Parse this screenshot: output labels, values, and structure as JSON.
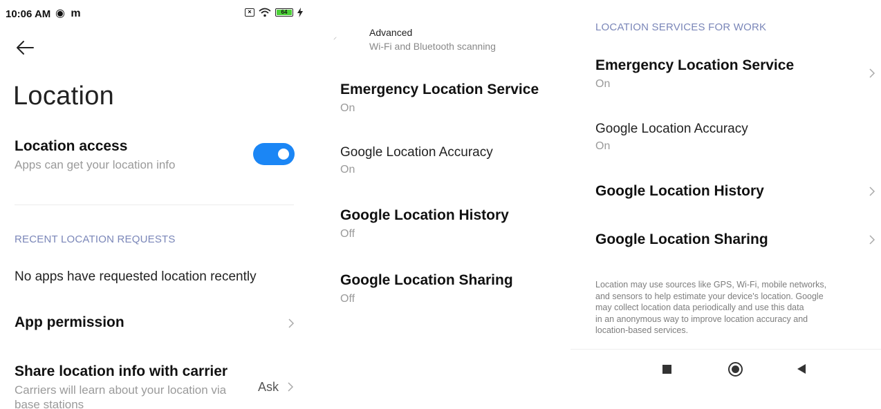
{
  "status_bar": {
    "time": "10:06 AM",
    "battery": "64"
  },
  "panel1": {
    "title": "Location",
    "location_access": {
      "title": "Location access",
      "subtitle": "Apps can get your location info",
      "enabled": true
    },
    "recent_header": "RECENT LOCATION REQUESTS",
    "no_apps_text": "No apps have requested location recently",
    "app_permission": "App permission",
    "share_carrier": {
      "title": "Share location info with carrier",
      "subtitle_line1": "Carriers will learn about your location via",
      "subtitle_line2": "base stations",
      "value": "Ask"
    }
  },
  "panel2": {
    "advanced": {
      "title": "Advanced",
      "subtitle": "Wi-Fi and Bluetooth scanning"
    },
    "items": [
      {
        "title": "Emergency Location Service",
        "value": "On"
      },
      {
        "title": "Google Location Accuracy",
        "value": "On"
      },
      {
        "title": "Google Location History",
        "value": "Off"
      },
      {
        "title": "Google Location Sharing",
        "value": "Off"
      }
    ]
  },
  "panel3": {
    "section_header": "LOCATION SERVICES FOR WORK",
    "items": [
      {
        "title": "Emergency Location Service",
        "value": "On"
      },
      {
        "title": "Google Location Accuracy",
        "value": "On"
      },
      {
        "title": "Google Location History"
      },
      {
        "title": "Google Location Sharing"
      }
    ],
    "footer_lines": [
      "Location may use sources like GPS, Wi-Fi, mobile networks,",
      "and sensors to help estimate your device's location. Google",
      "may collect location data periodically and use this data",
      "in an anonymous way to improve location accuracy and",
      "location-based services."
    ]
  },
  "colors": {
    "accent": "#1b86f5",
    "section_header": "#7a86b8",
    "subtitle_gray": "#9a9a9a"
  }
}
